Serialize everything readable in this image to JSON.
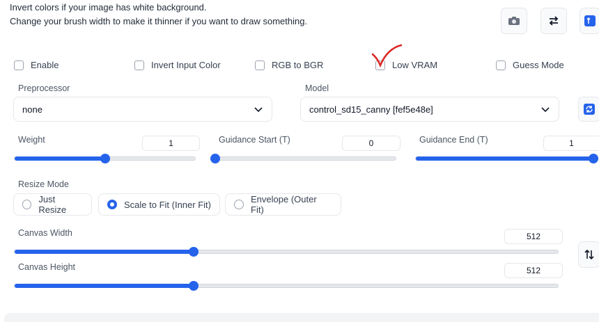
{
  "notes": {
    "line1": "Invert colors if your image has white background.",
    "line2": "Change your brush width to make it thinner if you want to draw something."
  },
  "top_buttons": [
    {
      "icon": "camera-icon"
    },
    {
      "icon": "swap-icon"
    },
    {
      "icon": "send-icon"
    }
  ],
  "checkboxes": {
    "enable": "Enable",
    "invert": "Invert Input Color",
    "rgb": "RGB to BGR",
    "lowvram": "Low VRAM",
    "guess": "Guess Mode"
  },
  "preprocessor": {
    "label": "Preprocessor",
    "value": "none"
  },
  "model": {
    "label": "Model",
    "value": "control_sd15_canny [fef5e48e]"
  },
  "weight": {
    "label": "Weight",
    "value": "1",
    "fraction": 0.5
  },
  "guidance_start": {
    "label": "Guidance Start (T)",
    "value": "0",
    "fraction": 0.0
  },
  "guidance_end": {
    "label": "Guidance End (T)",
    "value": "1",
    "fraction": 1.0
  },
  "resize_mode": {
    "label": "Resize Mode",
    "options": [
      "Just Resize",
      "Scale to Fit (Inner Fit)",
      "Envelope (Outer Fit)"
    ],
    "selected": "Scale to Fit (Inner Fit)"
  },
  "canvas_width": {
    "label": "Canvas Width",
    "value": "512",
    "fraction": 0.33
  },
  "canvas_height": {
    "label": "Canvas Height",
    "value": "512",
    "fraction": 0.33
  },
  "colors": {
    "accent": "#2563eb",
    "checkmark": "#dc2626"
  }
}
